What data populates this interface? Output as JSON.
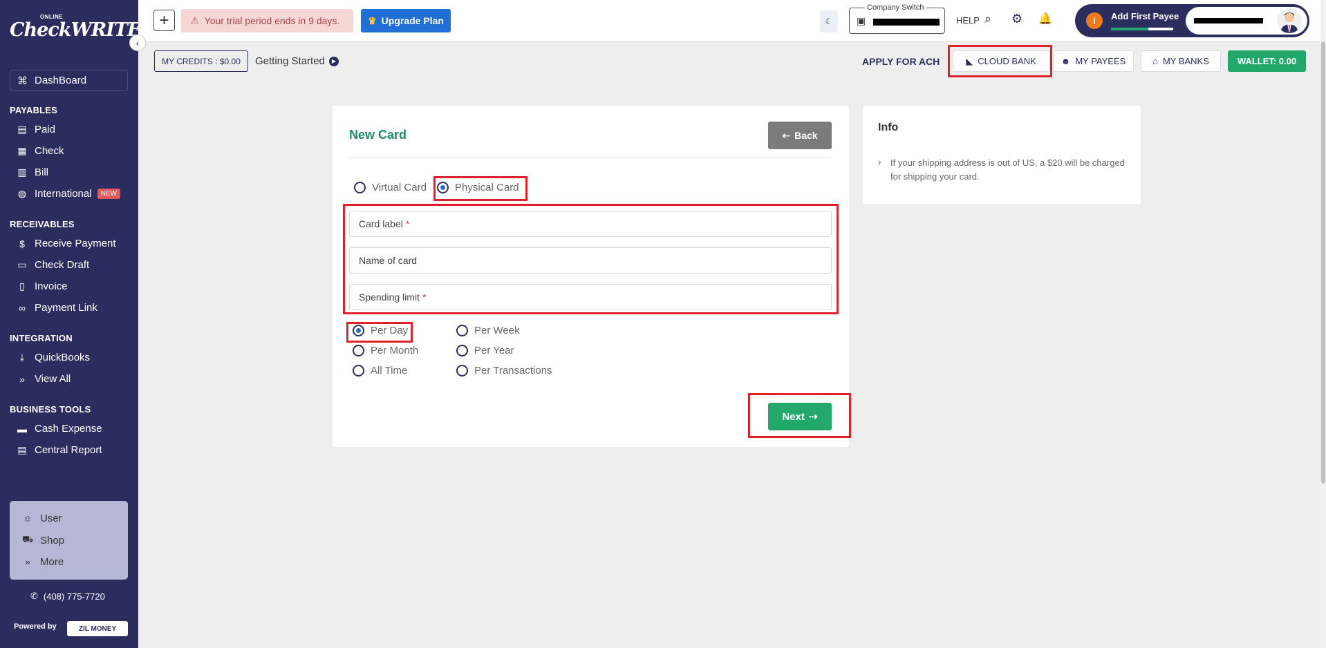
{
  "sidebar": {
    "logo_small": "ONLINE",
    "logo_big": "CheckWRITER",
    "dashboard": "DashBoard",
    "sections": {
      "payables": "PAYABLES",
      "receivables": "RECEIVABLES",
      "integration": "INTEGRATION",
      "business_tools": "BUSINESS TOOLS"
    },
    "payables_items": [
      "Paid",
      "Check",
      "Bill",
      "International"
    ],
    "new_badge": "NEW",
    "receivables_items": [
      "Receive Payment",
      "Check Draft",
      "Invoice",
      "Payment Link"
    ],
    "integration_items": [
      "QuickBooks",
      "View All"
    ],
    "business_items": [
      "Cash Expense",
      "Central Report"
    ],
    "bottom_items": [
      "User",
      "Shop",
      "More"
    ],
    "phone": "(408) 775-7720",
    "powered_by": "Powered by",
    "zil_money": "ZIL MONEY"
  },
  "topbar": {
    "trial_text": "Your trial period ends in 9 days.",
    "upgrade_label": "Upgrade Plan",
    "company_switch_label": "Company Switch",
    "help": "HELP",
    "add_first_payee": "Add First Payee",
    "payee_progress": 0.6
  },
  "subbar": {
    "credits": "MY CREDITS : $0.00",
    "getting_started": "Getting Started",
    "apply_ach": "APPLY FOR ACH",
    "cloud_bank": "CLOUD BANK",
    "my_payees": "MY PAYEES",
    "my_banks": "MY BANKS",
    "wallet": "WALLET: 0.00"
  },
  "card_form": {
    "title": "New Card",
    "back_label": "Back",
    "card_types": [
      "Virtual Card",
      "Physical Card"
    ],
    "selected_type": "Physical Card",
    "fields": {
      "card_label": "Card label",
      "name_of_card": "Name of card",
      "spending_limit": "Spending limit"
    },
    "required_mark": "*",
    "periods": [
      "Per Day",
      "Per Week",
      "Per Month",
      "Per Year",
      "All Time",
      "Per Transactions"
    ],
    "selected_period": "Per Day",
    "next_label": "Next"
  },
  "info": {
    "title": "Info",
    "text": "If your shipping address is out of US, a $20 will be charged for shipping your card."
  },
  "colors": {
    "sidebar_bg": "#2a2d5e",
    "accent_green": "#22a86b",
    "title_green": "#22876b",
    "highlight_red": "#e0202a",
    "upgrade_blue": "#1f6fd6"
  }
}
